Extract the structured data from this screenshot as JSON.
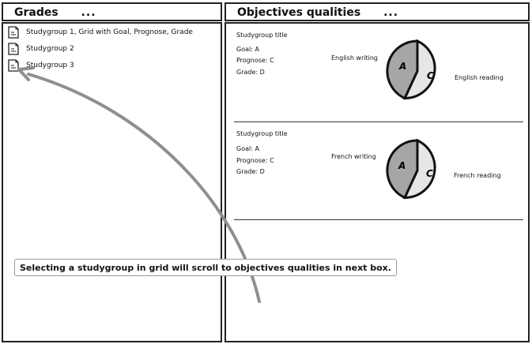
{
  "grades_panel": {
    "title": "Grades",
    "more": "...",
    "rows": [
      {
        "label": "Studygroup 1, Grid with Goal, Prognose, Grade",
        "icon": "document-icon"
      },
      {
        "label": "Studygroup 2",
        "icon": "document-icon"
      },
      {
        "label": "Studygroup 3",
        "icon": "document-icon"
      }
    ]
  },
  "objectives_panel": {
    "title": "Objectives qualities",
    "more": "...",
    "cards": [
      {
        "title": "Studygroup title",
        "goal": "Goal: A",
        "prognose": "Prognose: C",
        "grade": "Grade: D",
        "left_label": "English writing",
        "right_label": "English reading",
        "slice_a": "A",
        "slice_c": "C"
      },
      {
        "title": "Studygroup title",
        "goal": "Goal: A",
        "prognose": "Prognose: C",
        "grade": "Grade: D",
        "left_label": "French writing",
        "right_label": "French reading",
        "slice_a": "A",
        "slice_c": "C"
      }
    ]
  },
  "annotation": {
    "text": "Selecting a studygroup in grid will scroll to objectives qualities in next box."
  },
  "colors": {
    "slice_a": "#a6a6a6",
    "slice_c": "#e6e6e6",
    "arrow": "#8f8f8f",
    "border": "#222222"
  }
}
